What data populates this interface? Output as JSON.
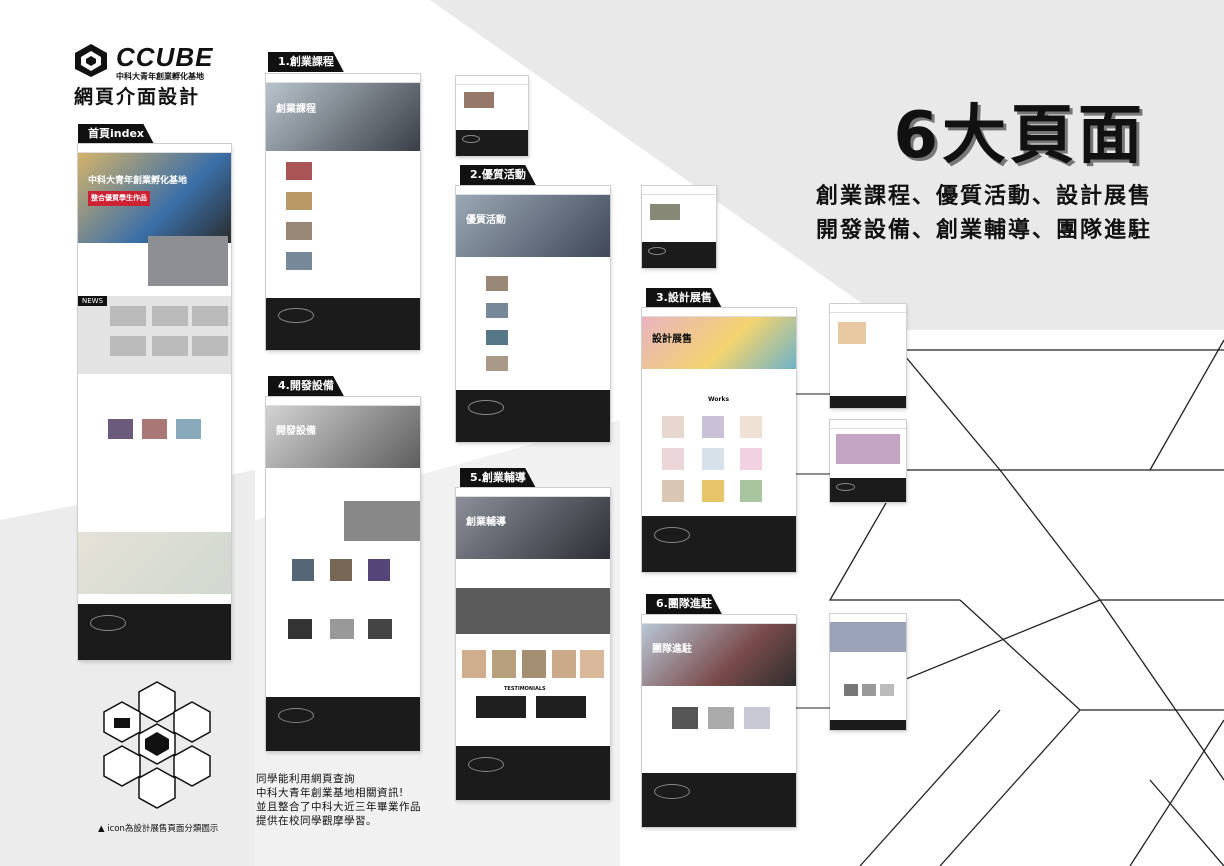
{
  "brand": {
    "logo_text": "CCUBE",
    "logo_sub": "中科大青年創業孵化基地",
    "heading": "網頁介面設計"
  },
  "headline": {
    "title": "6大頁面",
    "line1": "創業課程、優質活動、設計展售",
    "line2": "開發設備、創業輔導、團隊進駐"
  },
  "pages": {
    "index": {
      "tag": "首頁index",
      "hero": "中科大青年創業孵化基地",
      "hero_sub": "整合優質學生作品",
      "news": "NEWS"
    },
    "p1": {
      "tag": "1.創業課程",
      "hero": "創業課程"
    },
    "p2": {
      "tag": "2.優質活動",
      "hero": "優質活動"
    },
    "p3": {
      "tag": "3.設計展售",
      "hero": "設計展售",
      "section": "Works"
    },
    "p4": {
      "tag": "4.開發設備",
      "hero": "開發設備"
    },
    "p5": {
      "tag": "5.創業輔導",
      "hero": "創業輔導",
      "section": "TESTIMONIALS"
    },
    "p6": {
      "tag": "6.團隊進駐",
      "hero": "團隊進駐"
    }
  },
  "note": {
    "line1": "同學能利用網頁查詢",
    "line2": "中科大青年創業基地相關資訊!",
    "line3": "並且整合了中科大近三年畢業作品",
    "line4": "提供在校同學觀摩學習。"
  },
  "caption": "▲ icon為設計展售頁面分類圖示",
  "colors": {
    "dark": "#111111",
    "footer": "#1b1b1b",
    "bg_gray": "#e8e8e8"
  }
}
